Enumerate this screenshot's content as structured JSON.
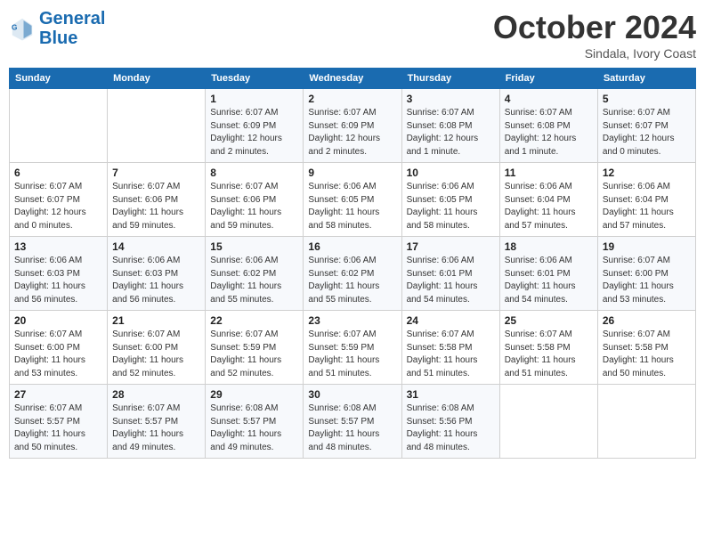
{
  "header": {
    "logo_line1": "General",
    "logo_line2": "Blue",
    "month": "October 2024",
    "location": "Sindala, Ivory Coast"
  },
  "weekdays": [
    "Sunday",
    "Monday",
    "Tuesday",
    "Wednesday",
    "Thursday",
    "Friday",
    "Saturday"
  ],
  "weeks": [
    [
      {
        "day": "",
        "detail": ""
      },
      {
        "day": "",
        "detail": ""
      },
      {
        "day": "1",
        "detail": "Sunrise: 6:07 AM\nSunset: 6:09 PM\nDaylight: 12 hours\nand 2 minutes."
      },
      {
        "day": "2",
        "detail": "Sunrise: 6:07 AM\nSunset: 6:09 PM\nDaylight: 12 hours\nand 2 minutes."
      },
      {
        "day": "3",
        "detail": "Sunrise: 6:07 AM\nSunset: 6:08 PM\nDaylight: 12 hours\nand 1 minute."
      },
      {
        "day": "4",
        "detail": "Sunrise: 6:07 AM\nSunset: 6:08 PM\nDaylight: 12 hours\nand 1 minute."
      },
      {
        "day": "5",
        "detail": "Sunrise: 6:07 AM\nSunset: 6:07 PM\nDaylight: 12 hours\nand 0 minutes."
      }
    ],
    [
      {
        "day": "6",
        "detail": "Sunrise: 6:07 AM\nSunset: 6:07 PM\nDaylight: 12 hours\nand 0 minutes."
      },
      {
        "day": "7",
        "detail": "Sunrise: 6:07 AM\nSunset: 6:06 PM\nDaylight: 11 hours\nand 59 minutes."
      },
      {
        "day": "8",
        "detail": "Sunrise: 6:07 AM\nSunset: 6:06 PM\nDaylight: 11 hours\nand 59 minutes."
      },
      {
        "day": "9",
        "detail": "Sunrise: 6:06 AM\nSunset: 6:05 PM\nDaylight: 11 hours\nand 58 minutes."
      },
      {
        "day": "10",
        "detail": "Sunrise: 6:06 AM\nSunset: 6:05 PM\nDaylight: 11 hours\nand 58 minutes."
      },
      {
        "day": "11",
        "detail": "Sunrise: 6:06 AM\nSunset: 6:04 PM\nDaylight: 11 hours\nand 57 minutes."
      },
      {
        "day": "12",
        "detail": "Sunrise: 6:06 AM\nSunset: 6:04 PM\nDaylight: 11 hours\nand 57 minutes."
      }
    ],
    [
      {
        "day": "13",
        "detail": "Sunrise: 6:06 AM\nSunset: 6:03 PM\nDaylight: 11 hours\nand 56 minutes."
      },
      {
        "day": "14",
        "detail": "Sunrise: 6:06 AM\nSunset: 6:03 PM\nDaylight: 11 hours\nand 56 minutes."
      },
      {
        "day": "15",
        "detail": "Sunrise: 6:06 AM\nSunset: 6:02 PM\nDaylight: 11 hours\nand 55 minutes."
      },
      {
        "day": "16",
        "detail": "Sunrise: 6:06 AM\nSunset: 6:02 PM\nDaylight: 11 hours\nand 55 minutes."
      },
      {
        "day": "17",
        "detail": "Sunrise: 6:06 AM\nSunset: 6:01 PM\nDaylight: 11 hours\nand 54 minutes."
      },
      {
        "day": "18",
        "detail": "Sunrise: 6:06 AM\nSunset: 6:01 PM\nDaylight: 11 hours\nand 54 minutes."
      },
      {
        "day": "19",
        "detail": "Sunrise: 6:07 AM\nSunset: 6:00 PM\nDaylight: 11 hours\nand 53 minutes."
      }
    ],
    [
      {
        "day": "20",
        "detail": "Sunrise: 6:07 AM\nSunset: 6:00 PM\nDaylight: 11 hours\nand 53 minutes."
      },
      {
        "day": "21",
        "detail": "Sunrise: 6:07 AM\nSunset: 6:00 PM\nDaylight: 11 hours\nand 52 minutes."
      },
      {
        "day": "22",
        "detail": "Sunrise: 6:07 AM\nSunset: 5:59 PM\nDaylight: 11 hours\nand 52 minutes."
      },
      {
        "day": "23",
        "detail": "Sunrise: 6:07 AM\nSunset: 5:59 PM\nDaylight: 11 hours\nand 51 minutes."
      },
      {
        "day": "24",
        "detail": "Sunrise: 6:07 AM\nSunset: 5:58 PM\nDaylight: 11 hours\nand 51 minutes."
      },
      {
        "day": "25",
        "detail": "Sunrise: 6:07 AM\nSunset: 5:58 PM\nDaylight: 11 hours\nand 51 minutes."
      },
      {
        "day": "26",
        "detail": "Sunrise: 6:07 AM\nSunset: 5:58 PM\nDaylight: 11 hours\nand 50 minutes."
      }
    ],
    [
      {
        "day": "27",
        "detail": "Sunrise: 6:07 AM\nSunset: 5:57 PM\nDaylight: 11 hours\nand 50 minutes."
      },
      {
        "day": "28",
        "detail": "Sunrise: 6:07 AM\nSunset: 5:57 PM\nDaylight: 11 hours\nand 49 minutes."
      },
      {
        "day": "29",
        "detail": "Sunrise: 6:08 AM\nSunset: 5:57 PM\nDaylight: 11 hours\nand 49 minutes."
      },
      {
        "day": "30",
        "detail": "Sunrise: 6:08 AM\nSunset: 5:57 PM\nDaylight: 11 hours\nand 48 minutes."
      },
      {
        "day": "31",
        "detail": "Sunrise: 6:08 AM\nSunset: 5:56 PM\nDaylight: 11 hours\nand 48 minutes."
      },
      {
        "day": "",
        "detail": ""
      },
      {
        "day": "",
        "detail": ""
      }
    ]
  ]
}
